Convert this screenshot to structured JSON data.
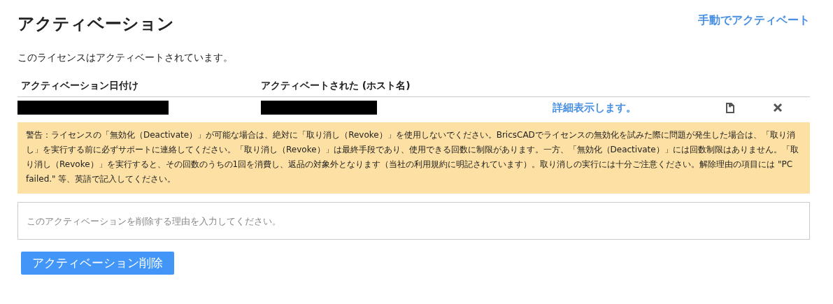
{
  "title": "アクティベーション",
  "manual_link": "手動でアクティベート",
  "status": "このライセンスはアクティベートされています。",
  "table": {
    "columns": [
      "アクティベーション日付け",
      "アクティベートされた (ホスト名)"
    ],
    "rows": [
      {
        "details_link": "詳細表示します。"
      }
    ]
  },
  "warning": "警告：ライセンスの「無効化（Deactivate）」が可能な場合は、絶対に「取り消し（Revoke）」を使用しないでください。BricsCADでライセンスの無効化を試みた際に問題が発生した場合は、「取り消し」を実行する前に必ずサポートに連絡してください。「取り消し（Revoke）」は最終手段であり、使用できる回数に制限があります。一方、「無効化（Deactivate）」には回数制限はありません。「取り消し（Revoke）」を実行すると、その回数のうちの1回を消費し、返品の対象外となります（当社の利用規約に明記されています）。取り消しの実行には十分ご注意ください。解除理由の項目には \"PC failed.\" 等、英語で記入してください。",
  "reason_field": {
    "placeholder": "このアクティベーションを削除する理由を入力してください。"
  },
  "delete_button": "アクティベーション削除"
}
